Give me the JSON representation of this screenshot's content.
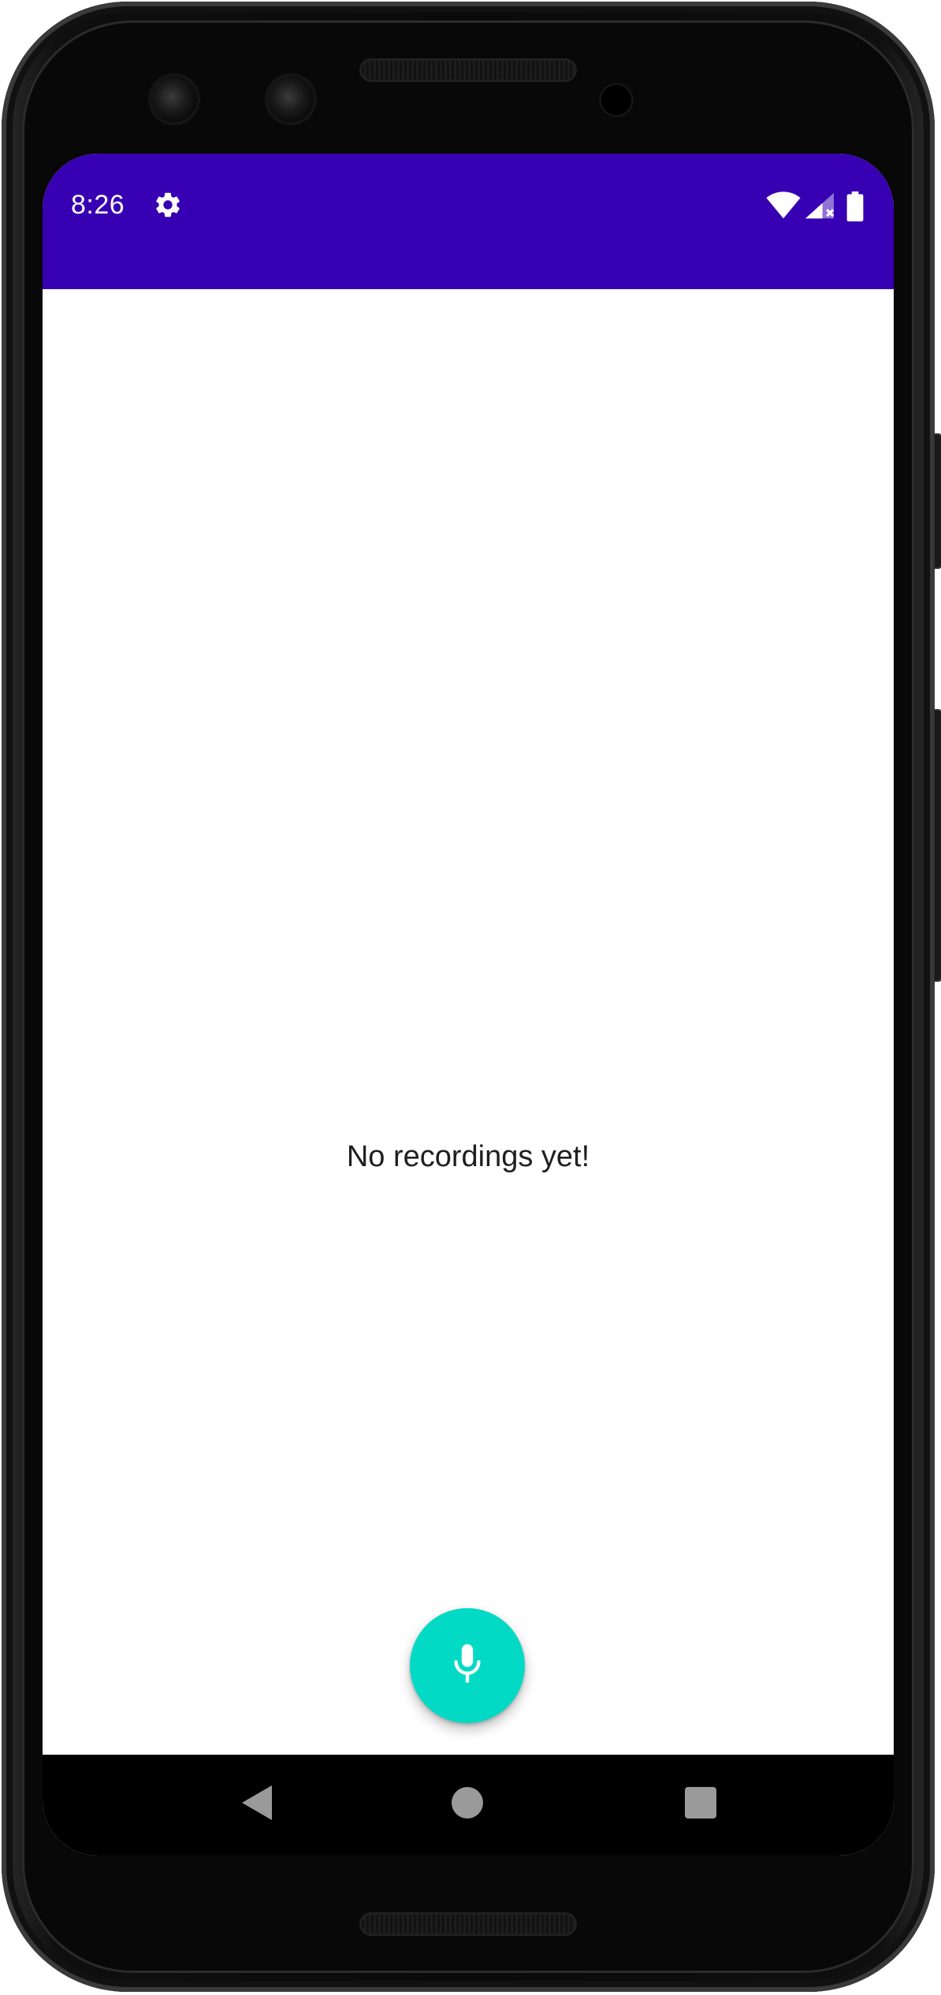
{
  "status_bar": {
    "time": "8:26",
    "background": "#3700b3",
    "icons": [
      "gear-icon",
      "wifi-icon",
      "signal-icon",
      "battery-icon"
    ]
  },
  "main": {
    "empty_message": "No recordings yet!"
  },
  "fab": {
    "icon": "microphone-icon",
    "color": "#03dac5"
  },
  "nav_bar": {
    "buttons": [
      "back-icon",
      "home-icon",
      "recents-icon"
    ]
  }
}
